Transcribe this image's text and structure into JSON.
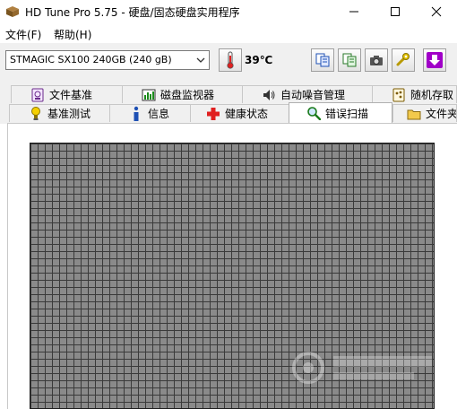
{
  "window": {
    "title": "HD Tune Pro 5.75 - 硬盘/固态硬盘实用程序"
  },
  "menu": {
    "file": "文件(F)",
    "help": "帮助(H)"
  },
  "toolbar": {
    "drive": "STMAGIC SX100 240GB (240 gB)",
    "temperature": "39℃"
  },
  "tabs_top": [
    {
      "label": "文件基准",
      "icon": "disk-benchmark-icon"
    },
    {
      "label": "磁盘监视器",
      "icon": "monitor-chart-icon"
    },
    {
      "label": "自动噪音管理",
      "icon": "speaker-icon"
    },
    {
      "label": "随机存取",
      "icon": "random-access-icon"
    }
  ],
  "tabs_bottom": [
    {
      "label": "基准测试",
      "icon": "benchmark-icon"
    },
    {
      "label": "信息",
      "icon": "info-icon"
    },
    {
      "label": "健康状态",
      "icon": "health-cross-icon"
    },
    {
      "label": "错误扫描",
      "icon": "magnifier-icon",
      "active": true
    },
    {
      "label": "文件夹",
      "icon": "folder-icon"
    }
  ],
  "colors": {
    "block_fill": "#8a8a8a",
    "block_border": "#3a3a3a",
    "health_red": "#e02020",
    "info_blue": "#1e50b4",
    "arrow_purple": "#a000c8"
  }
}
